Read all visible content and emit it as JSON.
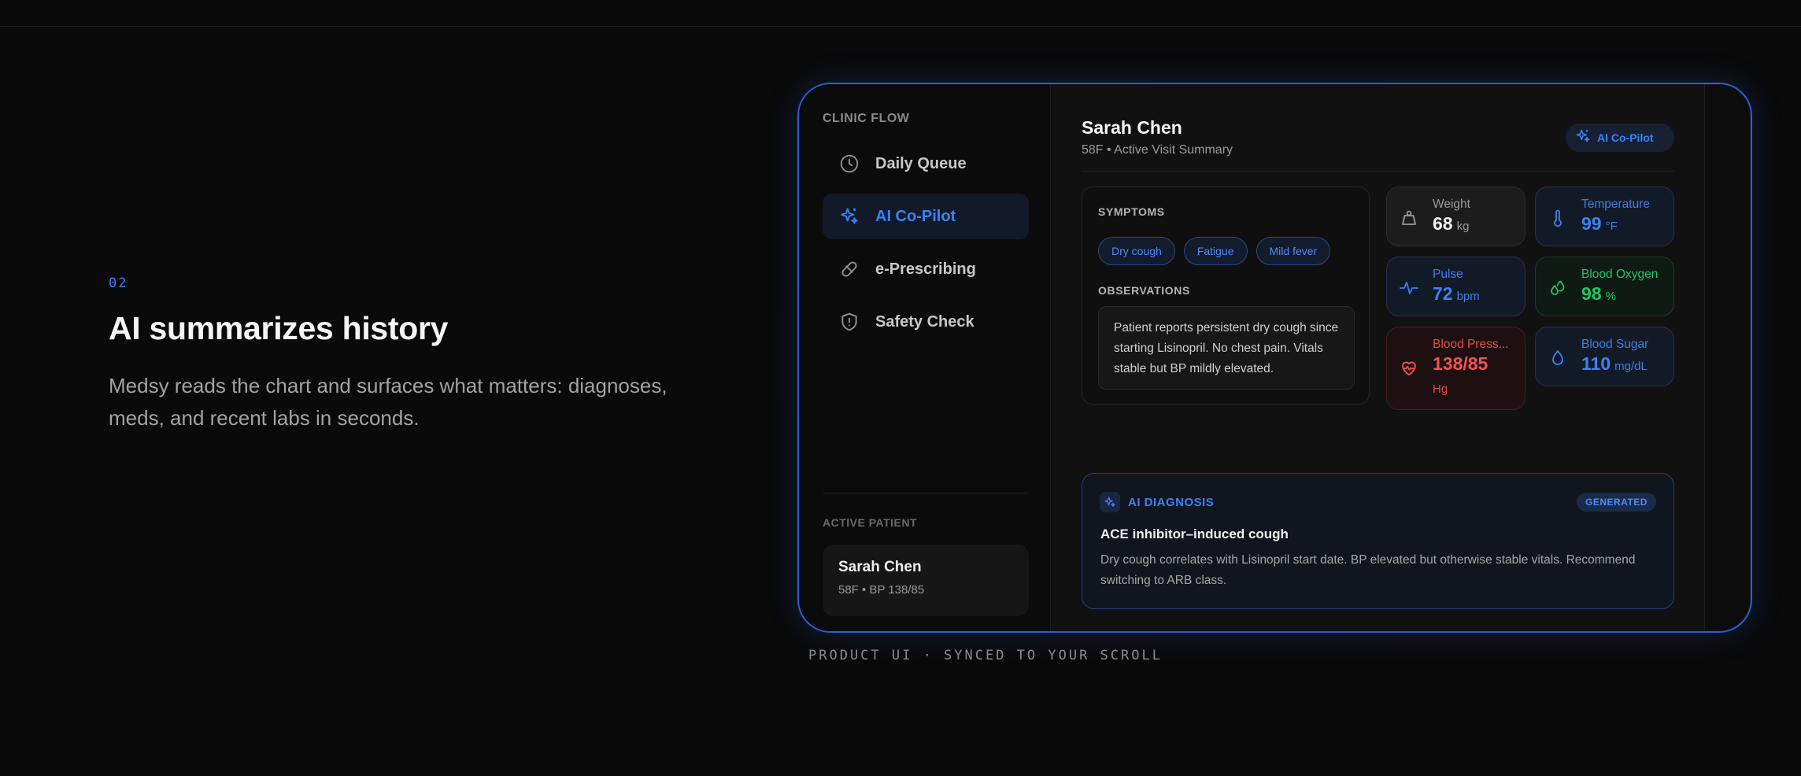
{
  "section": {
    "step_number": "02",
    "headline": "AI summarizes history",
    "description": "Medsy reads the chart and surfaces what matters: diagnoses, meds, and recent labs in seconds."
  },
  "sidebar": {
    "title": "CLINIC FLOW",
    "items": [
      {
        "label": "Daily Queue",
        "icon": "clock-icon",
        "active": false
      },
      {
        "label": "AI Co-Pilot",
        "icon": "sparkles-icon",
        "active": true
      },
      {
        "label": "e-Prescribing",
        "icon": "pill-icon",
        "active": false
      },
      {
        "label": "Safety Check",
        "icon": "shield-alert-icon",
        "active": false
      }
    ],
    "active_patient": {
      "title": "ACTIVE PATIENT",
      "name": "Sarah Chen",
      "meta": "58F • BP 138/85"
    }
  },
  "patient": {
    "name": "Sarah Chen",
    "subtitle": "58F • Active Visit Summary",
    "copilot_label": "AI Co-Pilot"
  },
  "symptoms": {
    "title": "SYMPTOMS",
    "chips": [
      "Dry cough",
      "Fatigue",
      "Mild fever"
    ],
    "observations_title": "OBSERVATIONS",
    "observations": "Patient reports persistent dry cough since starting Lisinopril. No chest pain. Vitals stable but BP mildly elevated."
  },
  "vitals": [
    {
      "label": "Weight",
      "value": "68",
      "unit": "kg",
      "tone": "gray",
      "icon": "weight-icon"
    },
    {
      "label": "Temperature",
      "value": "99",
      "unit": "°F",
      "tone": "blue",
      "icon": "thermometer-icon"
    },
    {
      "label": "Pulse",
      "value": "72",
      "unit": "bpm",
      "tone": "blue",
      "icon": "pulse-icon"
    },
    {
      "label": "Blood Oxygen",
      "value": "98",
      "unit": "%",
      "tone": "green",
      "icon": "droplets-icon"
    },
    {
      "label": "Blood Press...",
      "value": "138/85",
      "unit": "Hg",
      "tone": "red",
      "icon": "heart-pulse-icon"
    },
    {
      "label": "Blood Sugar",
      "value": "110",
      "unit": "mg/dL",
      "tone": "blue",
      "icon": "droplet-icon"
    }
  ],
  "diagnosis": {
    "title": "AI DIAGNOSIS",
    "badge": "GENERATED",
    "name": "ACE inhibitor–induced cough",
    "body": "Dry cough correlates with Lisinopril start date. BP elevated but otherwise stable vitals. Recommend switching to ARB class."
  },
  "caption": "PRODUCT UI · SYNCED TO YOUR SCROLL",
  "colors": {
    "accent": "#3b82f6",
    "green": "#22c55e",
    "red": "#f05252",
    "background": "#0a0a0a"
  }
}
